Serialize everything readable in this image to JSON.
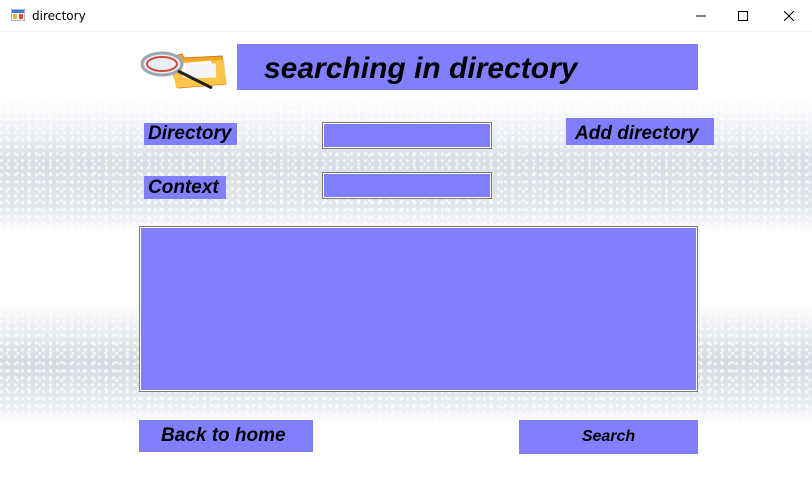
{
  "window": {
    "title": "directory",
    "controls": {
      "minimize": "minimize-icon",
      "maximize": "maximize-icon",
      "close": "close-icon"
    }
  },
  "header": {
    "title": "searching in directory",
    "logo_icon": "magnifier-folder-icon"
  },
  "form": {
    "directory_label": "Directory",
    "directory_value": "",
    "context_label": "Context",
    "context_value": "",
    "add_directory_label": "Add directory",
    "results_value": ""
  },
  "footer": {
    "back_label": "Back to home",
    "search_label": "Search"
  },
  "colors": {
    "accent": "#8080ff",
    "background": "#ffffff",
    "text": "#000000"
  }
}
